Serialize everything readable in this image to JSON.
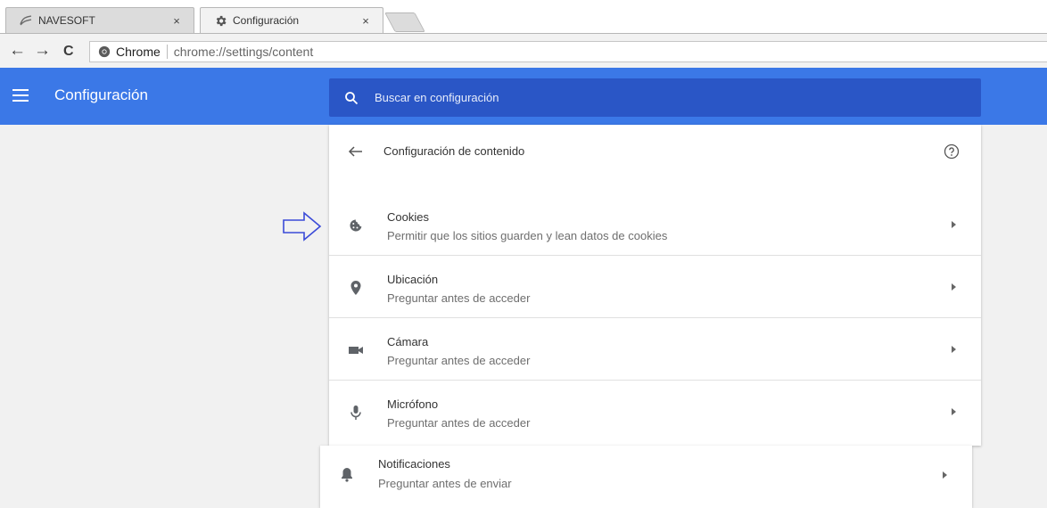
{
  "tabs": [
    {
      "title": "NAVESOFT",
      "close": "×",
      "icon": "navesoft-logo-icon"
    },
    {
      "title": "Configuración",
      "close": "×",
      "icon": "gear-icon"
    }
  ],
  "toolbar": {
    "back": "←",
    "forward": "→",
    "reload": "C",
    "scheme_label": "Chrome",
    "url": "chrome://settings/content"
  },
  "header": {
    "title": "Configuración",
    "search_placeholder": "Buscar en configuración"
  },
  "card": {
    "title": "Configuración de contenido",
    "items": [
      {
        "label": "Cookies",
        "sub": "Permitir que los sitios guarden y lean datos de cookies",
        "icon": "cookie-icon"
      },
      {
        "label": "Ubicación",
        "sub": "Preguntar antes de acceder",
        "icon": "location-pin-icon"
      },
      {
        "label": "Cámara",
        "sub": "Preguntar antes de acceder",
        "icon": "camera-icon"
      },
      {
        "label": "Micrófono",
        "sub": "Preguntar antes de acceder",
        "icon": "microphone-icon"
      }
    ]
  },
  "extra_item": {
    "label": "Notificaciones",
    "sub": "Preguntar antes de enviar",
    "icon": "bell-icon"
  },
  "colors": {
    "header_blue": "#3b78e7",
    "search_blue": "#2a56c6",
    "pointer_arrow": "#3b4bd8"
  }
}
